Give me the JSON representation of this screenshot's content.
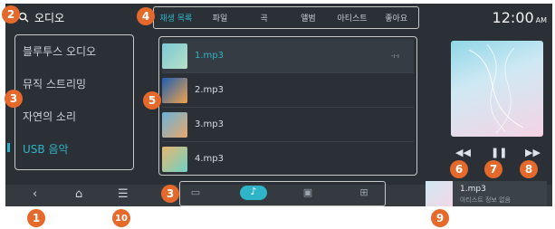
{
  "topbar": {
    "search_label": "오디오",
    "clock_time": "12:00",
    "clock_ampm": "AM"
  },
  "tabs": [
    {
      "label": "재생 목록",
      "active": true
    },
    {
      "label": "파일",
      "active": false
    },
    {
      "label": "곡",
      "active": false
    },
    {
      "label": "앨범",
      "active": false
    },
    {
      "label": "아티스트",
      "active": false
    },
    {
      "label": "좋아요",
      "active": false
    }
  ],
  "sources": [
    {
      "label": "블루투스 오디오",
      "active": false
    },
    {
      "label": "뮤직 스트리밍",
      "active": false
    },
    {
      "label": "자연의 소리",
      "active": false
    },
    {
      "label": "USB 음악",
      "active": true
    }
  ],
  "tracks": [
    {
      "title": "1.mp3",
      "playing": true
    },
    {
      "title": "2.mp3",
      "playing": false
    },
    {
      "title": "3.mp3",
      "playing": false
    },
    {
      "title": "4.mp3",
      "playing": false
    }
  ],
  "mini_player": {
    "title": "1.mp3",
    "subtitle": "아티스트 정보 없음"
  },
  "callouts": [
    "2",
    "4",
    "3",
    "5",
    "3",
    "6",
    "7",
    "8",
    "9",
    "1",
    "10"
  ],
  "colors": {
    "accent": "#2fb4c7",
    "background": "#2a3036",
    "callout": "#e4692b"
  },
  "icons": {
    "search": "search-icon",
    "playing": "equalizer-icon",
    "prev": "rewind-icon",
    "pause": "pause-icon",
    "next": "fast-forward-icon",
    "back": "back-icon",
    "home": "home-icon",
    "menu": "menu-icon",
    "radio": "radio-icon",
    "media": "music-icon",
    "tv": "tv-icon",
    "more": "apps-icon"
  }
}
